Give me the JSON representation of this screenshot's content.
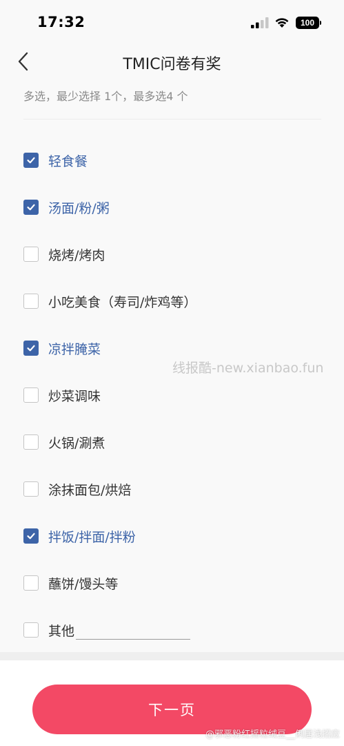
{
  "status_bar": {
    "time": "17:32",
    "battery": "100",
    "icons": [
      "signal-icon",
      "wifi-icon",
      "battery-icon"
    ]
  },
  "nav": {
    "title": "TMIC问卷有奖",
    "back_icon": "chevron-left-icon"
  },
  "question": {
    "hint": "多选，最少选择 1个，最多选4 个"
  },
  "options": [
    {
      "label": "轻食餐",
      "checked": true
    },
    {
      "label": "汤面/粉/粥",
      "checked": true
    },
    {
      "label": "烧烤/烤肉",
      "checked": false
    },
    {
      "label": "小吃美食（寿司/炸鸡等）",
      "checked": false
    },
    {
      "label": "凉拌腌菜",
      "checked": true
    },
    {
      "label": "炒菜调味",
      "checked": false
    },
    {
      "label": "火锅/涮煮",
      "checked": false
    },
    {
      "label": "涂抹面包/烘焙",
      "checked": false
    },
    {
      "label": "拌饭/拌面/拌粉",
      "checked": true
    },
    {
      "label": "蘸饼/馒头等",
      "checked": false
    },
    {
      "label": "其他",
      "checked": false,
      "has_input": true,
      "input_value": ""
    }
  ],
  "watermark": "线报酷-new.xianbao.fun",
  "footer": {
    "next_label": "下一页",
    "watermark": "@邪恶粉红摇粒绒豆__俐居浅招应"
  },
  "colors": {
    "accent": "#3d64a8",
    "button": "#f34965"
  }
}
